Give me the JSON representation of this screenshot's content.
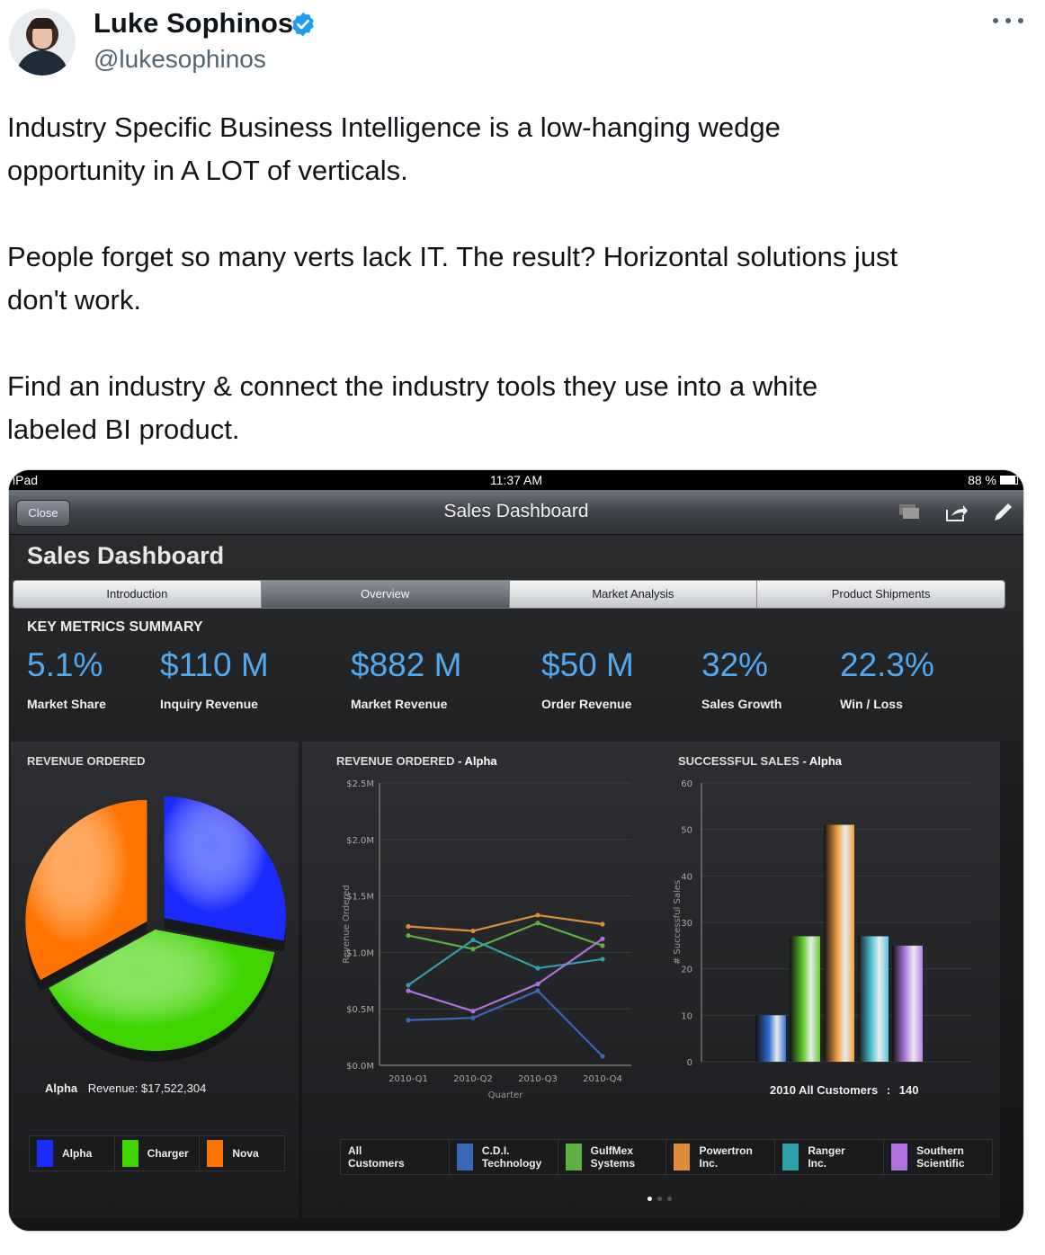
{
  "tweet": {
    "display_name": "Luke Sophinos",
    "handle": "@lukesophinos",
    "paragraphs": [
      "Industry Specific Business Intelligence is a low-hanging wedge\nopportunity in A LOT of verticals.",
      "People forget so many verts lack IT. The result? Horizontal solutions just\ndon't work.",
      "Find an industry & connect the industry tools they use into a white\nlabeled BI product."
    ]
  },
  "ipad": {
    "carrier": "iPad",
    "time": "11:37 AM",
    "battery": "88 %",
    "close_label": "Close",
    "nav_title": "Sales Dashboard"
  },
  "dashboard": {
    "title": "Sales Dashboard",
    "tabs": [
      "Introduction",
      "Overview",
      "Market Analysis",
      "Product Shipments"
    ],
    "active_tab": "Overview",
    "kms_title": "KEY METRICS SUMMARY",
    "metrics": [
      {
        "value": "5.1%",
        "label": "Market Share"
      },
      {
        "value": "$110 M",
        "label": "Inquiry Revenue"
      },
      {
        "value": "$882 M",
        "label": "Market Revenue"
      },
      {
        "value": "$50 M",
        "label": "Order Revenue"
      },
      {
        "value": "32%",
        "label": "Sales Growth"
      },
      {
        "value": "22.3%",
        "label": "Win / Loss"
      }
    ]
  },
  "pie_panel": {
    "title": "REVENUE ORDERED",
    "summary_name": "Alpha",
    "summary_text": "Revenue:  $17,522,304",
    "legend": [
      {
        "label": "Alpha",
        "color": "#1b2bff"
      },
      {
        "label": "Charger",
        "color": "#3fd400"
      },
      {
        "label": "Nova",
        "color": "#ff7400"
      }
    ]
  },
  "line_panel": {
    "title": "REVENUE ORDERED",
    "title_sub": " - Alpha",
    "legend": [
      {
        "label": "All\nCustomers",
        "color": null
      },
      {
        "label": "C.D.I.\nTechnology",
        "color": "#3a67b8"
      },
      {
        "label": "GulfMex\nSystems",
        "color": "#5fb040"
      },
      {
        "label": "Powertron\nInc.",
        "color": "#e08c3a"
      },
      {
        "label": "Ranger\nInc.",
        "color": "#2fa0a8"
      },
      {
        "label": "Southern\nScientific",
        "color": "#b070e0"
      }
    ]
  },
  "bar_panel": {
    "title": "SUCCESSFUL SALES",
    "title_sub": " - Alpha",
    "footer_label": "2010 All Customers",
    "footer_sep": ":",
    "footer_value": "140"
  },
  "chart_data": [
    {
      "type": "pie",
      "labels": [
        "Alpha",
        "Charger",
        "Nova"
      ],
      "values": [
        28,
        39,
        33
      ],
      "colors": [
        "#1b2bff",
        "#3fd400",
        "#ff7400"
      ]
    },
    {
      "type": "line",
      "x": [
        "2010-Q1",
        "2010-Q2",
        "2010-Q3",
        "2010-Q4"
      ],
      "xlabel": "Quarter",
      "ylabel": "Revenue Ordered",
      "yticks": [
        "$0.0M",
        "$0.5M",
        "$1.0M",
        "$1.5M",
        "$2.0M",
        "$2.5M"
      ],
      "ylim": [
        0,
        2.5
      ],
      "series": [
        {
          "name": "C.D.I. Technology",
          "color": "#3a67b8",
          "values": [
            0.4,
            0.42,
            0.66,
            0.08
          ]
        },
        {
          "name": "GulfMex Systems",
          "color": "#5fb040",
          "values": [
            1.15,
            1.03,
            1.26,
            1.06
          ]
        },
        {
          "name": "Powertron Inc.",
          "color": "#e08c3a",
          "values": [
            1.23,
            1.19,
            1.33,
            1.25
          ]
        },
        {
          "name": "Ranger Inc.",
          "color": "#2fa0a8",
          "values": [
            0.71,
            1.11,
            0.86,
            0.94
          ]
        },
        {
          "name": "Southern Scientific",
          "color": "#b070e0",
          "values": [
            0.66,
            0.48,
            0.72,
            1.12
          ]
        }
      ]
    },
    {
      "type": "bar",
      "categories": [
        "C.D.I. Technology",
        "GulfMex Systems",
        "Powertron Inc.",
        "Ranger Inc.",
        "Southern Scientific"
      ],
      "values": [
        10,
        27,
        51,
        27,
        25
      ],
      "colors": [
        "#2e6fd6",
        "#5fcf2a",
        "#f0a040",
        "#50c8d8",
        "#b57ee8"
      ],
      "ylabel": "# Successful Sales",
      "yticks": [
        "0",
        "10",
        "20",
        "30",
        "40",
        "50",
        "60"
      ],
      "ylim": [
        0,
        60
      ]
    }
  ]
}
